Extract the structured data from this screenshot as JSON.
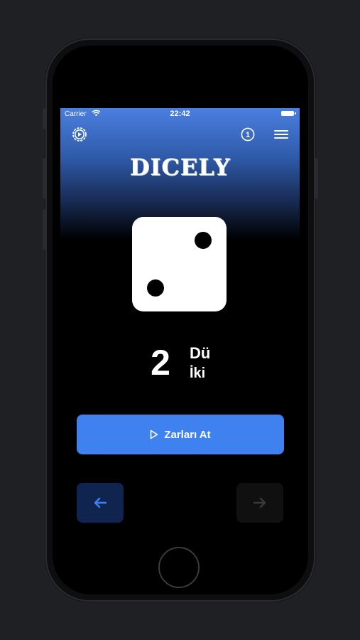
{
  "status_bar": {
    "carrier": "Carrier",
    "time": "22:42"
  },
  "header": {
    "logo": "DICELY",
    "settings_icon": "settings-icon",
    "info_badge": "1",
    "menu_icon": "menu-icon"
  },
  "die": {
    "face_value": 2
  },
  "result": {
    "number": "2",
    "word_line1": "Dü",
    "word_line2": "İki"
  },
  "actions": {
    "roll_label": "Zarları At",
    "roll_icon": "play-icon",
    "prev_icon": "arrow-left-icon",
    "next_icon": "arrow-right-icon"
  },
  "colors": {
    "accent": "#3f81ee",
    "header_gradient_top": "#4a7fe0",
    "background": "#000000",
    "prev_button_bg": "#0f2550",
    "next_button_bg": "#101010",
    "prev_arrow": "#3f81ee",
    "next_arrow_disabled": "#3a3a3a"
  }
}
